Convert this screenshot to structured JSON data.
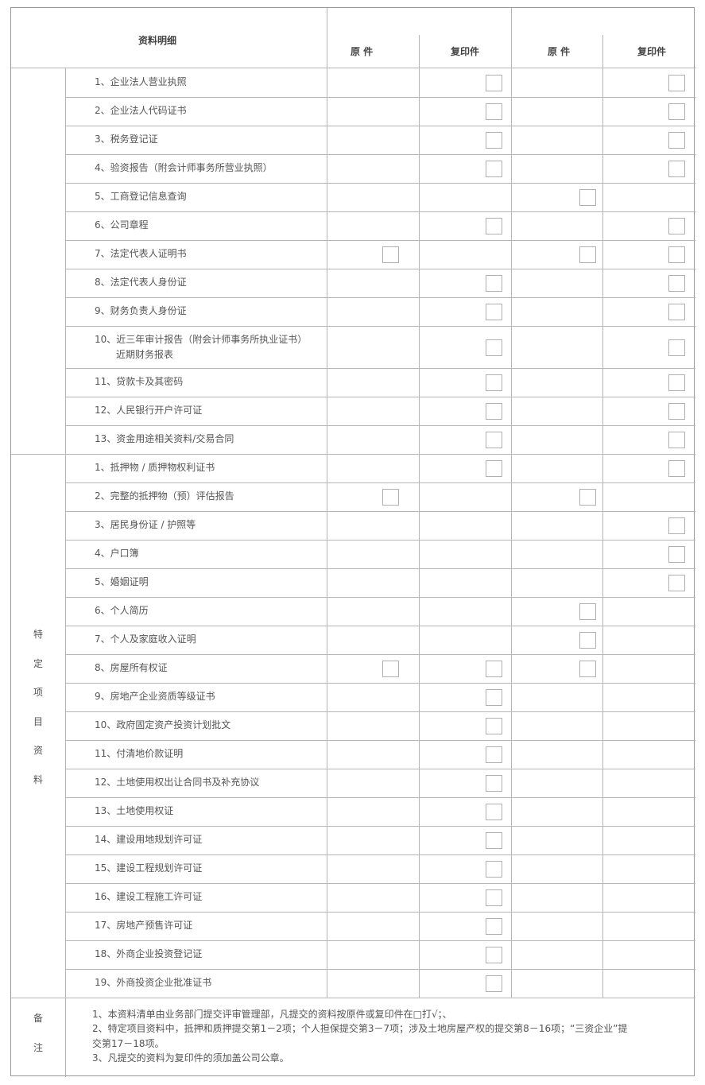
{
  "header": {
    "title": "资料明细",
    "col1": "原 件",
    "col2": "复印件",
    "col3": "原 件",
    "col4": "复印件"
  },
  "section2_label": [
    "特",
    "定",
    "项",
    "目",
    "资",
    "料"
  ],
  "notes_label": [
    "备",
    "注"
  ],
  "section1": [
    {
      "label": "1、企业法人营业执照",
      "checks": [
        false,
        true,
        false,
        true
      ]
    },
    {
      "label": "2、企业法人代码证书",
      "checks": [
        false,
        true,
        false,
        true
      ]
    },
    {
      "label": "3、税务登记证",
      "checks": [
        false,
        true,
        false,
        true
      ]
    },
    {
      "label": "4、验资报告（附会计师事务所营业执照）",
      "checks": [
        false,
        true,
        false,
        true
      ]
    },
    {
      "label": "5、工商登记信息查询",
      "checks": [
        false,
        false,
        true,
        false
      ]
    },
    {
      "label": "6、公司章程",
      "checks": [
        false,
        true,
        false,
        true
      ]
    },
    {
      "label": "7、法定代表人证明书",
      "checks": [
        true,
        false,
        true,
        true
      ]
    },
    {
      "label": "8、法定代表人身份证",
      "checks": [
        false,
        true,
        false,
        true
      ]
    },
    {
      "label": "9、财务负责人身份证",
      "checks": [
        false,
        true,
        false,
        true
      ]
    },
    {
      "label": "10、近三年审计报告（附会计师事务所执业证书）",
      "label2": "近期财务报表",
      "checks": [
        false,
        true,
        false,
        true
      ]
    },
    {
      "label": "11、贷款卡及其密码",
      "checks": [
        false,
        true,
        false,
        true
      ]
    },
    {
      "label": "12、人民银行开户许可证",
      "checks": [
        false,
        true,
        false,
        true
      ]
    },
    {
      "label": "13、资金用途相关资料/交易合同",
      "checks": [
        false,
        true,
        false,
        true
      ]
    }
  ],
  "section2": [
    {
      "label": "1、抵押物 / 质押物权利证书",
      "checks": [
        false,
        true,
        false,
        true
      ]
    },
    {
      "label": "2、完整的抵押物（预）评估报告",
      "checks": [
        true,
        false,
        true,
        false
      ]
    },
    {
      "label": "3、居民身份证 / 护照等",
      "checks": [
        false,
        false,
        false,
        true
      ]
    },
    {
      "label": "4、户口簿",
      "checks": [
        false,
        false,
        false,
        true
      ]
    },
    {
      "label": "5、婚姻证明",
      "checks": [
        false,
        false,
        false,
        true
      ]
    },
    {
      "label": "6、个人简历",
      "checks": [
        false,
        false,
        true,
        false
      ]
    },
    {
      "label": "7、个人及家庭收入证明",
      "checks": [
        false,
        false,
        true,
        false
      ]
    },
    {
      "label": "8、房屋所有权证",
      "checks": [
        true,
        true,
        true,
        false
      ]
    },
    {
      "label": "9、房地产企业资质等级证书",
      "checks": [
        false,
        true,
        false,
        false
      ]
    },
    {
      "label": "10、政府固定资产投资计划批文",
      "checks": [
        false,
        true,
        false,
        false
      ]
    },
    {
      "label": "11、付清地价款证明",
      "checks": [
        false,
        true,
        false,
        false
      ]
    },
    {
      "label": "12、土地使用权出让合同书及补充协议",
      "checks": [
        false,
        true,
        false,
        false
      ]
    },
    {
      "label": "13、土地使用权证",
      "checks": [
        false,
        true,
        false,
        false
      ]
    },
    {
      "label": "14、建设用地规划许可证",
      "checks": [
        false,
        true,
        false,
        false
      ]
    },
    {
      "label": "15、建设工程规划许可证",
      "checks": [
        false,
        true,
        false,
        false
      ]
    },
    {
      "label": "16、建设工程施工许可证",
      "checks": [
        false,
        true,
        false,
        false
      ]
    },
    {
      "label": "17、房地产预售许可证",
      "checks": [
        false,
        true,
        false,
        false
      ]
    },
    {
      "label": "18、外商企业投资登记证",
      "checks": [
        false,
        true,
        false,
        false
      ]
    },
    {
      "label": "19、外商投资企业批准证书",
      "checks": [
        false,
        true,
        false,
        false
      ]
    }
  ],
  "notes": [
    "1、本资料清单由业务部门提交评审管理部，凡提交的资料按原件或复印件在□打√；、",
    "2、特定项目资料中，抵押和质押提交第1－2项；个人担保提交第3－7项；涉及土地房屋产权的提交第8－16项；“三资企业”提",
    "交第17－18项。",
    "3、凡提交的资料为复印件的须加盖公司公章。"
  ]
}
